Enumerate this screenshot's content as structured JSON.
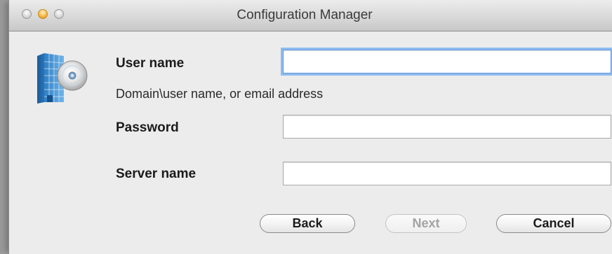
{
  "window": {
    "title": "Configuration Manager"
  },
  "form": {
    "username": {
      "label": "User name",
      "hint": "Domain\\user name, or email address",
      "value": "",
      "placeholder": ""
    },
    "password": {
      "label": "Password",
      "value": "",
      "placeholder": ""
    },
    "server": {
      "label": "Server name",
      "value": "",
      "placeholder": ""
    }
  },
  "buttons": {
    "back": "Back",
    "next": "Next",
    "cancel": "Cancel"
  },
  "icons": {
    "app": "configuration-manager-icon"
  },
  "colors": {
    "focus_ring": "#8fbbf0",
    "window_bg": "#ececec",
    "disabled_text": "#a3a3a3"
  }
}
